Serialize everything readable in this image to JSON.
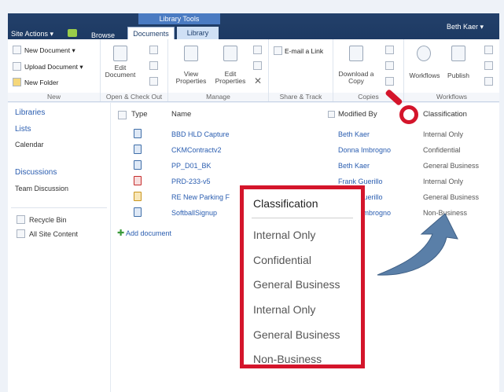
{
  "ribbon": {
    "library_tools": "Library Tools",
    "site_actions": "Site Actions ▾",
    "browse": "Browse",
    "tab_documents": "Documents",
    "tab_library": "Library",
    "user": "Beth Kaer ▾",
    "new_document": "New Document ▾",
    "upload_document": "Upload Document ▾",
    "new_folder": "New Folder",
    "group_new": "New",
    "edit_document": "Edit Document",
    "group_open": "Open & Check Out",
    "view_properties": "View Properties",
    "edit_properties": "Edit Properties",
    "group_manage": "Manage",
    "email_link": "E-mail a Link",
    "group_share": "Share & Track",
    "download_copy": "Download a Copy",
    "group_copies": "Copies",
    "workflows": "Workflows",
    "publish": "Publish",
    "group_workflows": "Workflows"
  },
  "sidebar": {
    "libraries": "Libraries",
    "lists": "Lists",
    "calendar": "Calendar",
    "discussions": "Discussions",
    "team_discussion": "Team Discussion",
    "recycle_bin": "Recycle Bin",
    "all_site_content": "All Site Content"
  },
  "table": {
    "col_type": "Type",
    "col_name": "Name",
    "col_modified": "Modified By",
    "col_classification": "Classification",
    "rows": [
      {
        "name": "BBD HLD Capture",
        "modified": "Beth Kaer",
        "classification": "Internal Only"
      },
      {
        "name": "CKMContractv2",
        "modified": "Donna Imbrogno",
        "classification": "Confidential"
      },
      {
        "name": "PP_D01_BK",
        "modified": "Beth Kaer",
        "classification": "General Business"
      },
      {
        "name": "PRD-233-v5",
        "modified": "Frank Guerillo",
        "classification": "Internal Only"
      },
      {
        "name": "RE New Parking F",
        "modified": "Frank Guerillo",
        "classification": "General Business"
      },
      {
        "name": "SoftballSignup",
        "modified": "Donna Imbrogno",
        "classification": "Non-Business"
      }
    ],
    "add_document": "Add document"
  },
  "popup": {
    "title": "Classification",
    "items": [
      "Internal Only",
      "Confidential",
      "General Business",
      "Internal Only",
      "General Business",
      "Non-Business"
    ]
  },
  "colors": {
    "ribbon_dark": "#1d3a63",
    "highlight": "#d4152b",
    "link": "#2a5db0",
    "arrow": "#5a7fa8"
  }
}
